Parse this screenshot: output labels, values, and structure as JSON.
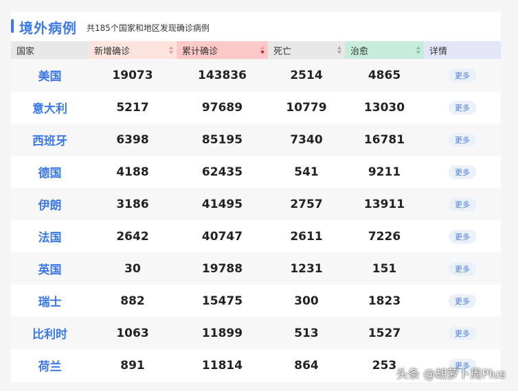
{
  "header": {
    "title": "境外病例",
    "subtitle": "共185个国家和地区发现确诊病例"
  },
  "columns": [
    {
      "label": "国家",
      "bg": "#e8e8e8",
      "sortable": false
    },
    {
      "label": "新增确诊",
      "bg": "#fde3de",
      "sortable": true,
      "sort_color": "#e8a090",
      "active": false
    },
    {
      "label": "累计确诊",
      "bg": "#fcc8c8",
      "sortable": true,
      "sort_color": "#c0262b",
      "active": true
    },
    {
      "label": "死亡",
      "bg": "#e8e8e8",
      "sortable": true,
      "sort_color": "#aaaaaa",
      "active": false
    },
    {
      "label": "治愈",
      "bg": "#c8ecdc",
      "sortable": true,
      "sort_color": "#7cc8a4",
      "active": false
    },
    {
      "label": "详情",
      "bg": "#e2e6f8",
      "sortable": false
    }
  ],
  "rows": [
    {
      "country": "美国",
      "new": "19073",
      "total": "143836",
      "deaths": "2514",
      "cured": "4865",
      "more": "更多"
    },
    {
      "country": "意大利",
      "new": "5217",
      "total": "97689",
      "deaths": "10779",
      "cured": "13030",
      "more": "更多"
    },
    {
      "country": "西班牙",
      "new": "6398",
      "total": "85195",
      "deaths": "7340",
      "cured": "16781",
      "more": "更多"
    },
    {
      "country": "德国",
      "new": "4188",
      "total": "62435",
      "deaths": "541",
      "cured": "9211",
      "more": "更多"
    },
    {
      "country": "伊朗",
      "new": "3186",
      "total": "41495",
      "deaths": "2757",
      "cured": "13911",
      "more": "更多"
    },
    {
      "country": "法国",
      "new": "2642",
      "total": "40747",
      "deaths": "2611",
      "cured": "7226",
      "more": "更多"
    },
    {
      "country": "英国",
      "new": "30",
      "total": "19788",
      "deaths": "1231",
      "cured": "151",
      "more": "更多"
    },
    {
      "country": "瑞士",
      "new": "882",
      "total": "15475",
      "deaths": "300",
      "cured": "1823",
      "more": "更多"
    },
    {
      "country": "比利时",
      "new": "1063",
      "total": "11899",
      "deaths": "513",
      "cured": "1527",
      "more": "更多"
    },
    {
      "country": "荷兰",
      "new": "891",
      "total": "11814",
      "deaths": "864",
      "cured": "253",
      "more": "更多"
    }
  ],
  "watermark": "头条 @胡萝卜周Plus",
  "colors": {
    "accent": "#3c78e6",
    "more_bg": "#eaf1fb",
    "row_alt": "#f7f7f7"
  }
}
